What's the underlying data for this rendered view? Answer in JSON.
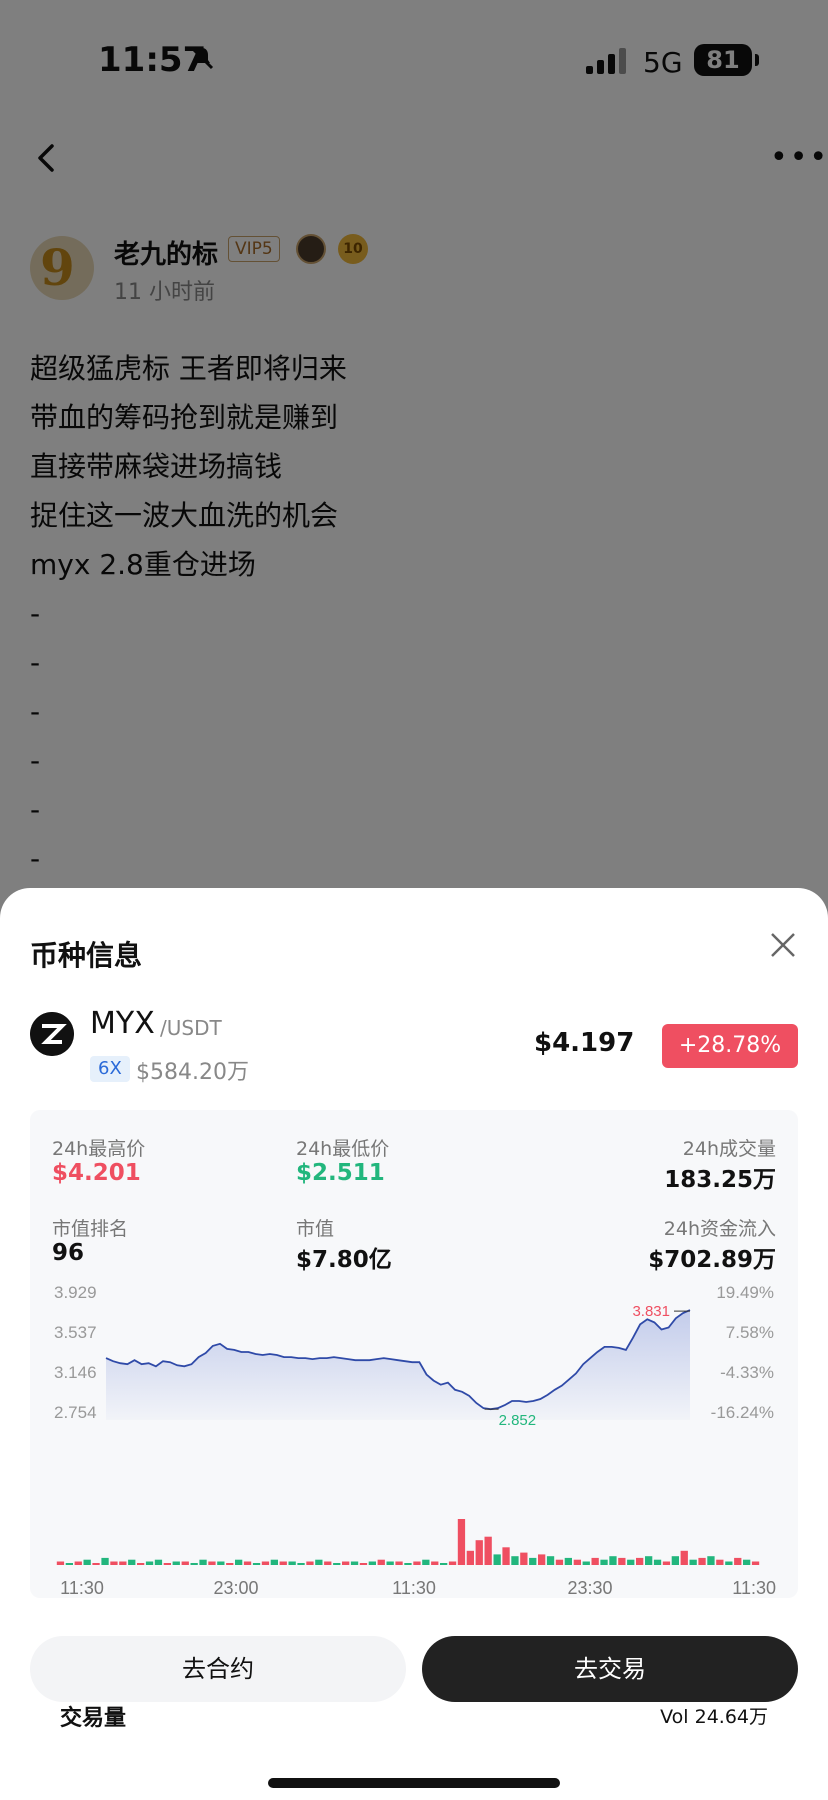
{
  "status_bar": {
    "time": "11:57",
    "network": "5G",
    "battery": "81"
  },
  "post": {
    "author": "老九的标",
    "vip": "VIP5",
    "medal_level": "10",
    "time_ago": "11 小时前",
    "lines": [
      "超级猛虎标 王者即将归来",
      "带血的筹码抢到就是赚到",
      "直接带麻袋进场搞钱",
      "捉住这一波大血洗的机会",
      "myx 2.8重仓进场",
      "-",
      "-",
      "-",
      "-",
      "-",
      "-"
    ]
  },
  "sheet": {
    "title": "币种信息",
    "coin": {
      "symbol": "MYX",
      "pair": "/USDT",
      "leverage": "6X",
      "market_cap": "$584.20万",
      "price": "$4.197",
      "change": "+28.78%"
    },
    "stats": {
      "high_label": "24h最高价",
      "high": "$4.201",
      "low_label": "24h最低价",
      "low": "$2.511",
      "volume_label": "24h成交量",
      "volume": "183.25万",
      "rank_label": "市值排名",
      "rank": "96",
      "mcap_label": "市值",
      "mcap": "$7.80亿",
      "inflow_label": "24h资金流入",
      "inflow": "$702.89万"
    },
    "volume_title": "交易量",
    "volume_value": "Vol 24.64万",
    "buttons": {
      "contract": "去合约",
      "trade": "去交易"
    }
  },
  "colors": {
    "up": "#ef4f61",
    "down": "#22b67d",
    "line": "#2f4aa8"
  },
  "chart_data": [
    {
      "type": "area",
      "title": "",
      "ylim": [
        2.754,
        3.929
      ],
      "y_tick_labels": [
        "3.929",
        "3.537",
        "3.146",
        "2.754"
      ],
      "y2_tick_labels": [
        "19.49%",
        "7.58%",
        "-4.33%",
        "-16.24%"
      ],
      "annotations": [
        {
          "label": "3.831"
        },
        {
          "label": "2.852"
        }
      ],
      "series": [
        {
          "values": [
            3.36,
            3.33,
            3.31,
            3.3,
            3.34,
            3.3,
            3.31,
            3.28,
            3.33,
            3.32,
            3.29,
            3.28,
            3.3,
            3.37,
            3.41,
            3.48,
            3.5,
            3.45,
            3.44,
            3.42,
            3.42,
            3.4,
            3.39,
            3.4,
            3.39,
            3.37,
            3.37,
            3.36,
            3.36,
            3.35,
            3.36,
            3.36,
            3.37,
            3.36,
            3.35,
            3.34,
            3.34,
            3.34,
            3.35,
            3.36,
            3.35,
            3.34,
            3.33,
            3.32,
            3.32,
            3.2,
            3.14,
            3.1,
            3.12,
            3.05,
            3.03,
            2.99,
            2.92,
            2.87,
            2.86,
            2.87,
            2.9,
            2.94,
            2.94,
            2.93,
            2.94,
            2.96,
            3.0,
            3.05,
            3.09,
            3.15,
            3.21,
            3.3,
            3.36,
            3.42,
            3.47,
            3.47,
            3.46,
            3.44,
            3.56,
            3.69,
            3.74,
            3.71,
            3.64,
            3.66,
            3.75,
            3.8,
            3.83
          ]
        }
      ]
    },
    {
      "type": "bar",
      "title": "交易量",
      "x_tick_labels": [
        "11:30",
        "23:00",
        "11:30",
        "23:30",
        "11:30"
      ],
      "series": [
        {
          "values": [
            2,
            1,
            2,
            3,
            1,
            4,
            2,
            2,
            3,
            1,
            2,
            3,
            1,
            2,
            2,
            1,
            3,
            2,
            2,
            1,
            3,
            2,
            1,
            2,
            3,
            2,
            2,
            1,
            2,
            3,
            2,
            1,
            2,
            2,
            1,
            2,
            3,
            2,
            2,
            1,
            2,
            3,
            2,
            1,
            2,
            26,
            8,
            14,
            16,
            6,
            10,
            5,
            7,
            4,
            6,
            5,
            3,
            4,
            3,
            2,
            4,
            3,
            5,
            4,
            3,
            4,
            5,
            3,
            2,
            5,
            8,
            3,
            4,
            5,
            3,
            2,
            4,
            3,
            2
          ],
          "colors": [
            "u",
            "d",
            "u",
            "d",
            "u",
            "d",
            "u",
            "u",
            "d",
            "u",
            "d",
            "d",
            "u",
            "d",
            "u",
            "d",
            "d",
            "u",
            "d",
            "u",
            "d",
            "u",
            "d",
            "u",
            "d",
            "u",
            "d",
            "d",
            "u",
            "d",
            "u",
            "d",
            "u",
            "d",
            "u",
            "d",
            "u",
            "d",
            "u",
            "d",
            "u",
            "d",
            "u",
            "d",
            "u",
            "u",
            "u",
            "u",
            "u",
            "d",
            "u",
            "d",
            "u",
            "d",
            "u",
            "d",
            "u",
            "d",
            "u",
            "d",
            "u",
            "d",
            "d",
            "u",
            "d",
            "u",
            "d",
            "d",
            "u",
            "d",
            "u",
            "d",
            "u",
            "d",
            "u",
            "d",
            "u",
            "d",
            "u"
          ]
        }
      ]
    }
  ]
}
